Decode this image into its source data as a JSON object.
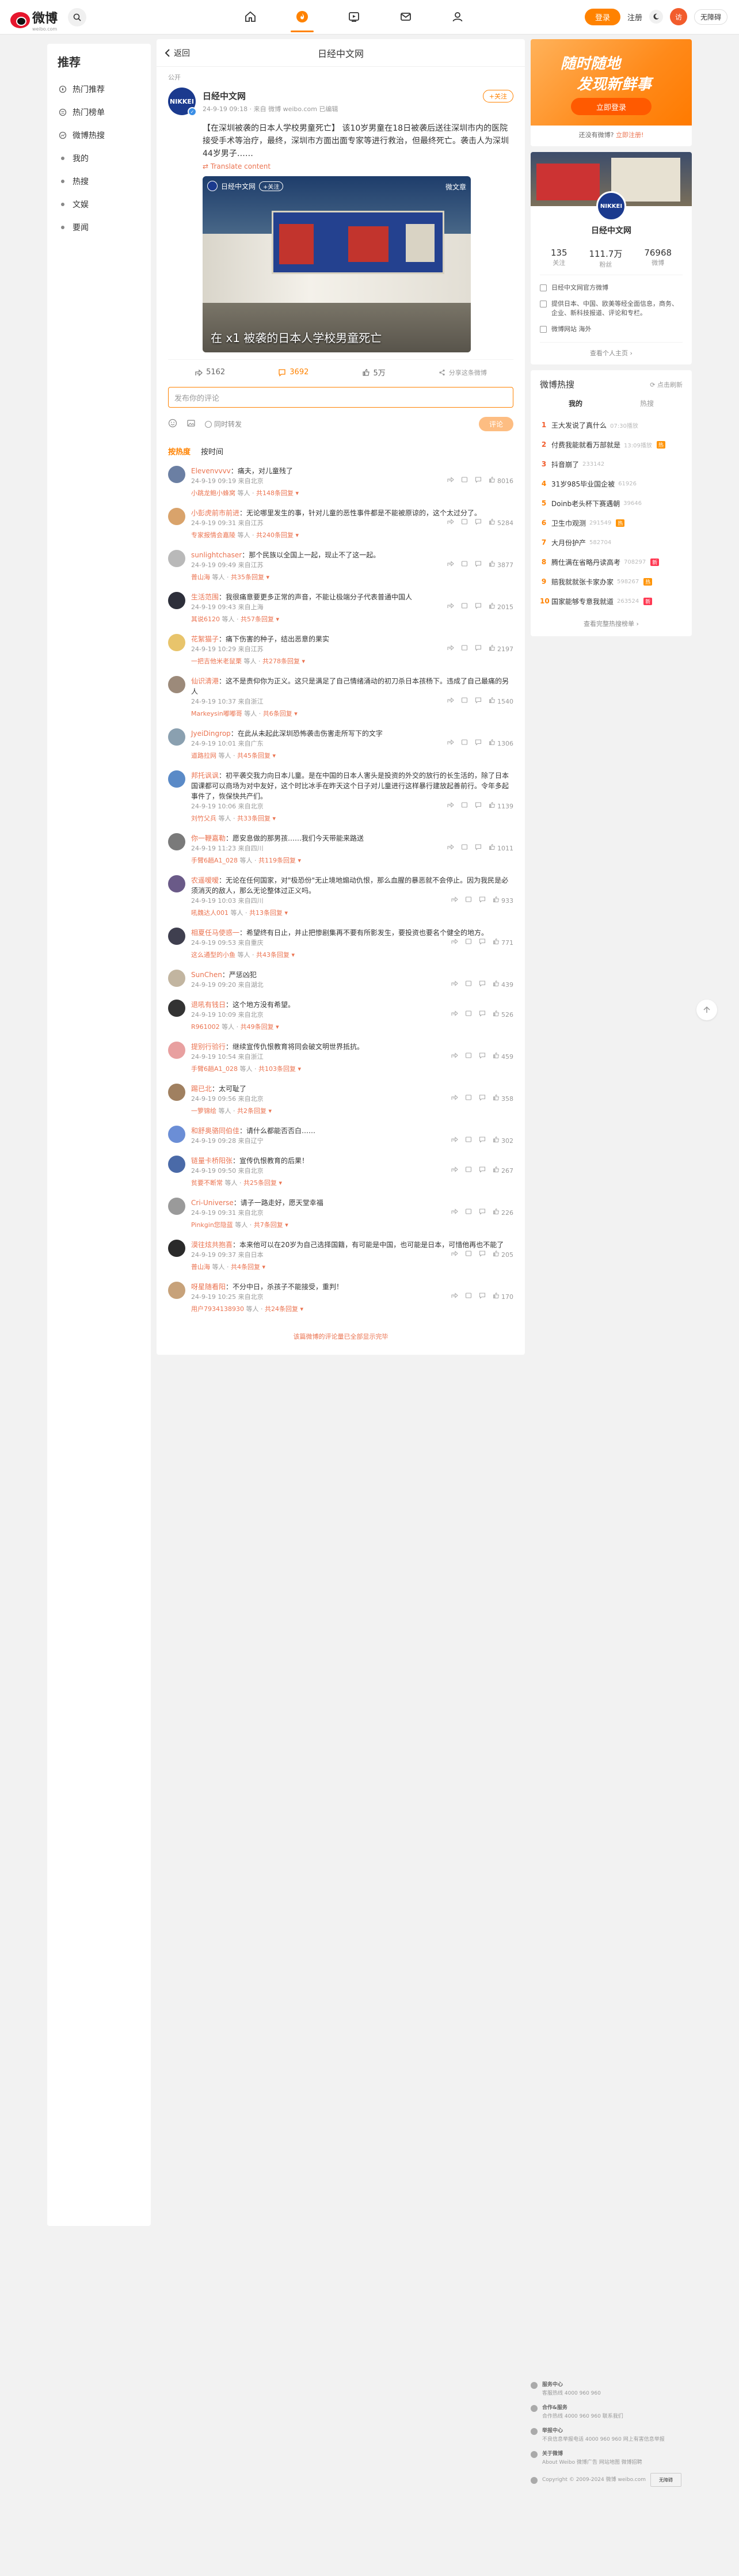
{
  "topbar": {
    "logo_text": "微博",
    "logo_sub": "weibo.com",
    "login_label": "登录",
    "register_label": "注册",
    "avatar_initial": "访",
    "access_label": "无障碍"
  },
  "leftnav": {
    "title": "推荐",
    "items": [
      {
        "label": "热门推荐"
      },
      {
        "label": "热门榜单"
      },
      {
        "label": "微博热搜"
      },
      {
        "label": "我的"
      },
      {
        "label": "热搜"
      },
      {
        "label": "文娱"
      },
      {
        "label": "要闻"
      }
    ]
  },
  "main": {
    "back_label": "返回",
    "title": "日经中文网",
    "pub_tag": "公开",
    "post": {
      "author": "日经中文网",
      "avatar_text": "NIKKEI",
      "meta": "24-9-19 09:18 · 来自 微博 weibo.com 已编辑",
      "follow_label": "+关注",
      "text": "【在深圳被袭的日本人学校男童死亡】 该10岁男童在18日被袭后送往深圳市内的医院接受手术等治疗，最终，深圳市方面出面专家等进行救治，但最终死亡。袭击人为深圳44岁男子……",
      "link": "Translate content",
      "image_tag_name": "日经中文网",
      "image_tag_follow": "+关注",
      "image_logo": "微文章",
      "image_caption": "在 x1 被袭的日本人学校男童死亡"
    },
    "actions": {
      "share": "5162",
      "comment": "3692",
      "like": "5万",
      "report": "分享这条微博"
    },
    "comment_placeholder": "发布你的评论",
    "forward_label": "同时转发",
    "submit_label": "评论",
    "sort_tabs": [
      "按热度",
      "按时间"
    ],
    "comments": [
      {
        "user": "Elevenvvvv",
        "text": "痛夫，对儿童残了",
        "meta": "24-9-19 09:19 来自北京",
        "likes": "8016",
        "reply_user": "小跳龙鲍小蜂窝",
        "reply_count": "共148条回复",
        "color": "#6b7fa3"
      },
      {
        "user": "小彭虎前市前进",
        "text": "无论哪里发生的事，针对儿童的恶性事件都是不能被原谅的，这个太过分了。",
        "meta": "24-9-19 09:31 来自江苏",
        "likes": "5284",
        "reply_user": "专家报情会嘉陵",
        "reply_count": "共240条回复",
        "color": "#d9a36b"
      },
      {
        "user": "sunlightchaser",
        "text": "那个民族以全国上一起，现止不了这一起。",
        "meta": "24-9-19 09:49 来自江苏",
        "likes": "3877",
        "reply_user": "普山海",
        "reply_count": "共35条回复",
        "color": "#b9b9b9"
      },
      {
        "user": "生活范围",
        "text": "我很痛意要更多正常的声音，不能让极端分子代表普通中国人",
        "meta": "24-9-19 09:43 来自上海",
        "likes": "2015",
        "reply_user": "其说6120",
        "reply_count": "共57条回复",
        "color": "#2d2f3a"
      },
      {
        "user": "花絮猫子",
        "text": "痛下伤害的种子，结出恶意的果实",
        "meta": "24-9-19 10:29 来自江苏",
        "likes": "2197",
        "reply_user": "一把吉他米老鼠栗",
        "reply_count": "共278条回复",
        "color": "#e8c46b"
      },
      {
        "user": "仙识清港",
        "text": "这不是责仰你为正义。这只是满足了自己情绪涌动的初刀杀日本孩杨下。违成了自己最痛的另人",
        "meta": "24-9-19 10:37 来自浙江",
        "likes": "1540",
        "reply_user": "Markeysin嘟嘟哥",
        "reply_count": "共6条回复",
        "color": "#9c8a7a"
      },
      {
        "user": "JyeiDingrop",
        "text": "在此从未起此深圳恐怖袭击伤害走所写下的文字",
        "meta": "24-9-19 10:01 来自广东",
        "likes": "1306",
        "reply_user": "道路拉网",
        "reply_count": "共45条回复",
        "color": "#8aa0b0"
      },
      {
        "user": "邦托讽讽",
        "text": "初平袭交我力向日本儿童。是在中国的日本人害头是投资的外交的放行的长生活的，除了日本国课都可以商场为对中友好，这个时比冰手在昨天这个日子对儿童进行这样暴行建放起善前行。令年多起事件了，恢保快共产们。",
        "meta": "24-9-19 10:06 来自北京",
        "likes": "1139",
        "reply_user": "刘竹父兵",
        "reply_count": "共33条回复",
        "color": "#5a8ac7"
      },
      {
        "user": "你一鞭嘉勒",
        "text": "愿安息做的那男孩……我们今天带能来路送",
        "meta": "24-9-19 11:23 来自四川",
        "likes": "1011",
        "reply_user": "手臂6趟A1_028",
        "reply_count": "共119条回复",
        "color": "#7a7a7a"
      },
      {
        "user": "农遥嗳嗳",
        "text": "无论在任何国家，对\"极恐份\"无止境地煽动仇恨，那么血腥的暴恶就不会停止。因为我民是必须消灭的敌人，那么无论整体过正义吗。",
        "meta": "24-9-19 10:03 来自四川",
        "likes": "933",
        "reply_user": "吼魏达人001",
        "reply_count": "共13条回复",
        "color": "#6a5a88"
      },
      {
        "user": "相夏任马使惑一",
        "text": "希望终有日止，并止把惨剧集再不要有所影发生，要投资也要名个健全的地方。",
        "meta": "24-9-19 09:53 来自重庆",
        "likes": "771",
        "reply_user": "这么通型的小鱼",
        "reply_count": "共43条回复",
        "color": "#3f3f4f"
      },
      {
        "user": "SunChen",
        "text": "严惩凶犯",
        "meta": "24-9-19 09:20 来自湖北",
        "likes": "439",
        "reply_user": "",
        "reply_count": "",
        "color": "#c2b5a0"
      },
      {
        "user": "退吼有钱日",
        "text": "这个地方没有希望。",
        "meta": "24-9-19 10:09 来自北京",
        "likes": "526",
        "reply_user": "R961002",
        "reply_count": "共49条回复",
        "color": "#333333"
      },
      {
        "user": "提别行验行",
        "text": "继续宣传仇恨教育将同会破文明世界抵抗。",
        "meta": "24-9-19 10:54 来自浙江",
        "likes": "459",
        "reply_user": "手臂6趟A1_028",
        "reply_count": "共103条回复",
        "color": "#e8a0a0"
      },
      {
        "user": "踢已北",
        "text": "太可耻了",
        "meta": "24-9-19 09:56 来自北京",
        "likes": "358",
        "reply_user": "一箩锦绘",
        "reply_count": "共2条回复",
        "color": "#a08060"
      },
      {
        "user": "和舒奥骆同伯佳",
        "text": "请什么都能否否白……",
        "meta": "24-9-19 09:28 来自辽宁",
        "likes": "302",
        "reply_user": "",
        "reply_count": "",
        "color": "#6b8ed6"
      },
      {
        "user": "链量卡桥阳张",
        "text": "宣传仇恨教育的后果！",
        "meta": "24-9-19 09:50 来自北京",
        "likes": "267",
        "reply_user": "贫要不断常",
        "reply_count": "共25条回复",
        "color": "#4a6aa8"
      },
      {
        "user": "Cri-Universe",
        "text": "请子一路走好，愿天堂幸福",
        "meta": "24-9-19 09:31 来自北京",
        "likes": "226",
        "reply_user": "Pinkgin您隐蓝",
        "reply_count": "共7条回复",
        "color": "#9a9a9a"
      },
      {
        "user": "漠往炫共抱喜",
        "text": "本来他可以在20岁为自己选择国籍，有可能是中国，也可能是日本，可惜他再也不能了",
        "meta": "24-9-19 09:37 来自日本",
        "likes": "205",
        "reply_user": "普山海",
        "reply_count": "共4条回复",
        "color": "#2a2a2a"
      },
      {
        "user": "呀星随看阳",
        "text": "不分中日，杀孩子不能接受，重判！",
        "meta": "24-9-19 10:25 来自北京",
        "likes": "170",
        "reply_user": "用户7934138930",
        "reply_count": "共24条回复",
        "color": "#c7a27a"
      }
    ],
    "more_comments": "该篇微博的评论量已全部显示完毕"
  },
  "right": {
    "promo": {
      "line1": "随时随地",
      "line2": "发现新鲜事",
      "button": "立即登录",
      "note_prefix": "还没有微博? ",
      "note_link": "立即注册!"
    },
    "profile": {
      "name": "日经中文网",
      "avatar_text": "NIKKEI",
      "stats": [
        {
          "value": "135",
          "label": "关注"
        },
        {
          "value": "111.7万",
          "label": "粉丝"
        },
        {
          "value": "76968",
          "label": "微博"
        }
      ],
      "info": [
        "日经中文网官方微博",
        "提供日本、中国、欧美等经全面信息，商务、企业、新科技报道、评论和专栏。",
        "微博网站  海外"
      ],
      "view_all": "查看个人主页"
    },
    "hot": {
      "title": "微博热搜",
      "refresh": "点击刷新",
      "tabs": [
        "我的",
        "热搜"
      ],
      "items": [
        {
          "rank": "1",
          "title": "王大发说了真什么",
          "num": "07:30播放",
          "badge": "",
          "badge_color": ""
        },
        {
          "rank": "2",
          "title": "付费我能就看万部就是",
          "num": "13:09播放",
          "badge": "热",
          "badge_color": "#ff9406"
        },
        {
          "rank": "3",
          "title": "抖音崩了",
          "num": "233142",
          "badge": "",
          "badge_color": ""
        },
        {
          "rank": "4",
          "title": "31岁985毕业国企被",
          "num": "61926",
          "badge": "",
          "badge_color": ""
        },
        {
          "rank": "5",
          "title": "Doinb老头杯下赛遇朝",
          "num": "39646",
          "badge": "",
          "badge_color": ""
        },
        {
          "rank": "6",
          "title": "卫生巾观测",
          "num": "291549",
          "badge": "热",
          "badge_color": "#ff9406"
        },
        {
          "rank": "7",
          "title": "大月份护产",
          "num": "582704",
          "badge": "",
          "badge_color": ""
        },
        {
          "rank": "8",
          "title": "腾仕满在省略丹读高考",
          "num": "708297",
          "badge": "新",
          "badge_color": "#ff3852"
        },
        {
          "rank": "9",
          "title": "赔我就就张卡家办家",
          "num": "598267",
          "badge": "热",
          "badge_color": "#ff9406"
        },
        {
          "rank": "10",
          "title": "国家能够专意我就道",
          "num": "263524",
          "badge": "新",
          "badge_color": "#ff3852"
        }
      ],
      "more": "查看完整热搜榜单"
    }
  },
  "footer": {
    "sections": [
      {
        "title": "服务中心",
        "text": "客服热线 4000 960 960"
      },
      {
        "title": "合作&服务",
        "text": "合作热线 4000 960 960  联系我们"
      },
      {
        "title": "举报中心",
        "text": "不良信息举报电话 4000 960 960  网上有害信息举报"
      },
      {
        "title": "关于微博",
        "text": "About Weibo  微博广告  网站地图  微博招聘"
      }
    ],
    "copyright": "Copyright © 2009-2024 微博 weibo.com",
    "qr_label": "无障碍"
  },
  "colors": {
    "accent": "#ff8200",
    "link": "#eb7350",
    "brand_red": "#e6162d"
  }
}
